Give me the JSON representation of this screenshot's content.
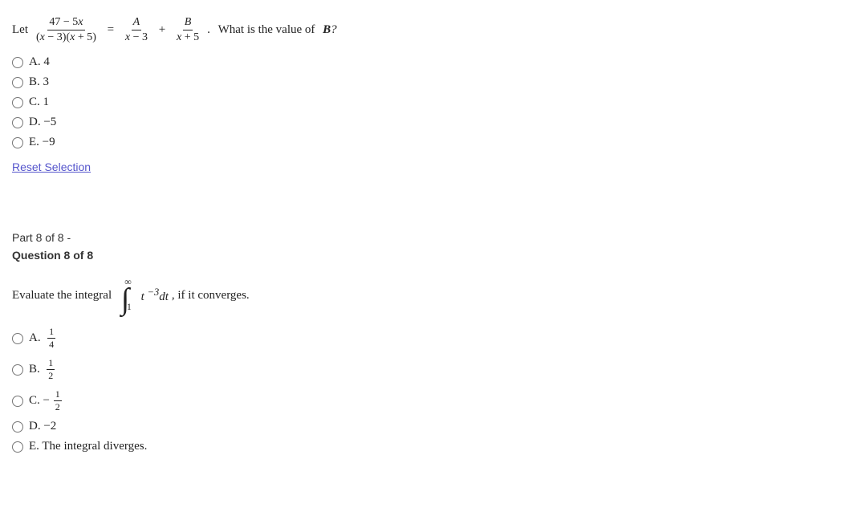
{
  "question7": {
    "intro": "Let",
    "what_is": "What is the value of",
    "var_b": "B?",
    "options": [
      {
        "id": "q7a",
        "label": "A. 4"
      },
      {
        "id": "q7b",
        "label": "B. 3"
      },
      {
        "id": "q7c",
        "label": "C. 1"
      },
      {
        "id": "q7d",
        "label": "D. –5"
      },
      {
        "id": "q7e",
        "label": "E. –9"
      }
    ],
    "reset_label": "Reset Selection"
  },
  "question8": {
    "part_label": "Part 8 of 8 -",
    "question_label": "Question 8 of 8",
    "intro": "Evaluate the integral",
    "condition": ", if it converges.",
    "options": [
      {
        "id": "q8a",
        "label_prefix": "A.",
        "fraction": {
          "num": "1",
          "den": "4"
        }
      },
      {
        "id": "q8b",
        "label_prefix": "B.",
        "fraction": {
          "num": "1",
          "den": "2"
        }
      },
      {
        "id": "q8c",
        "label_prefix": "C.",
        "fraction": {
          "num": "1",
          "den": "2"
        },
        "negative": true
      },
      {
        "id": "q8d",
        "label": "D. –2"
      },
      {
        "id": "q8e",
        "label": "E. The integral diverges."
      }
    ]
  }
}
